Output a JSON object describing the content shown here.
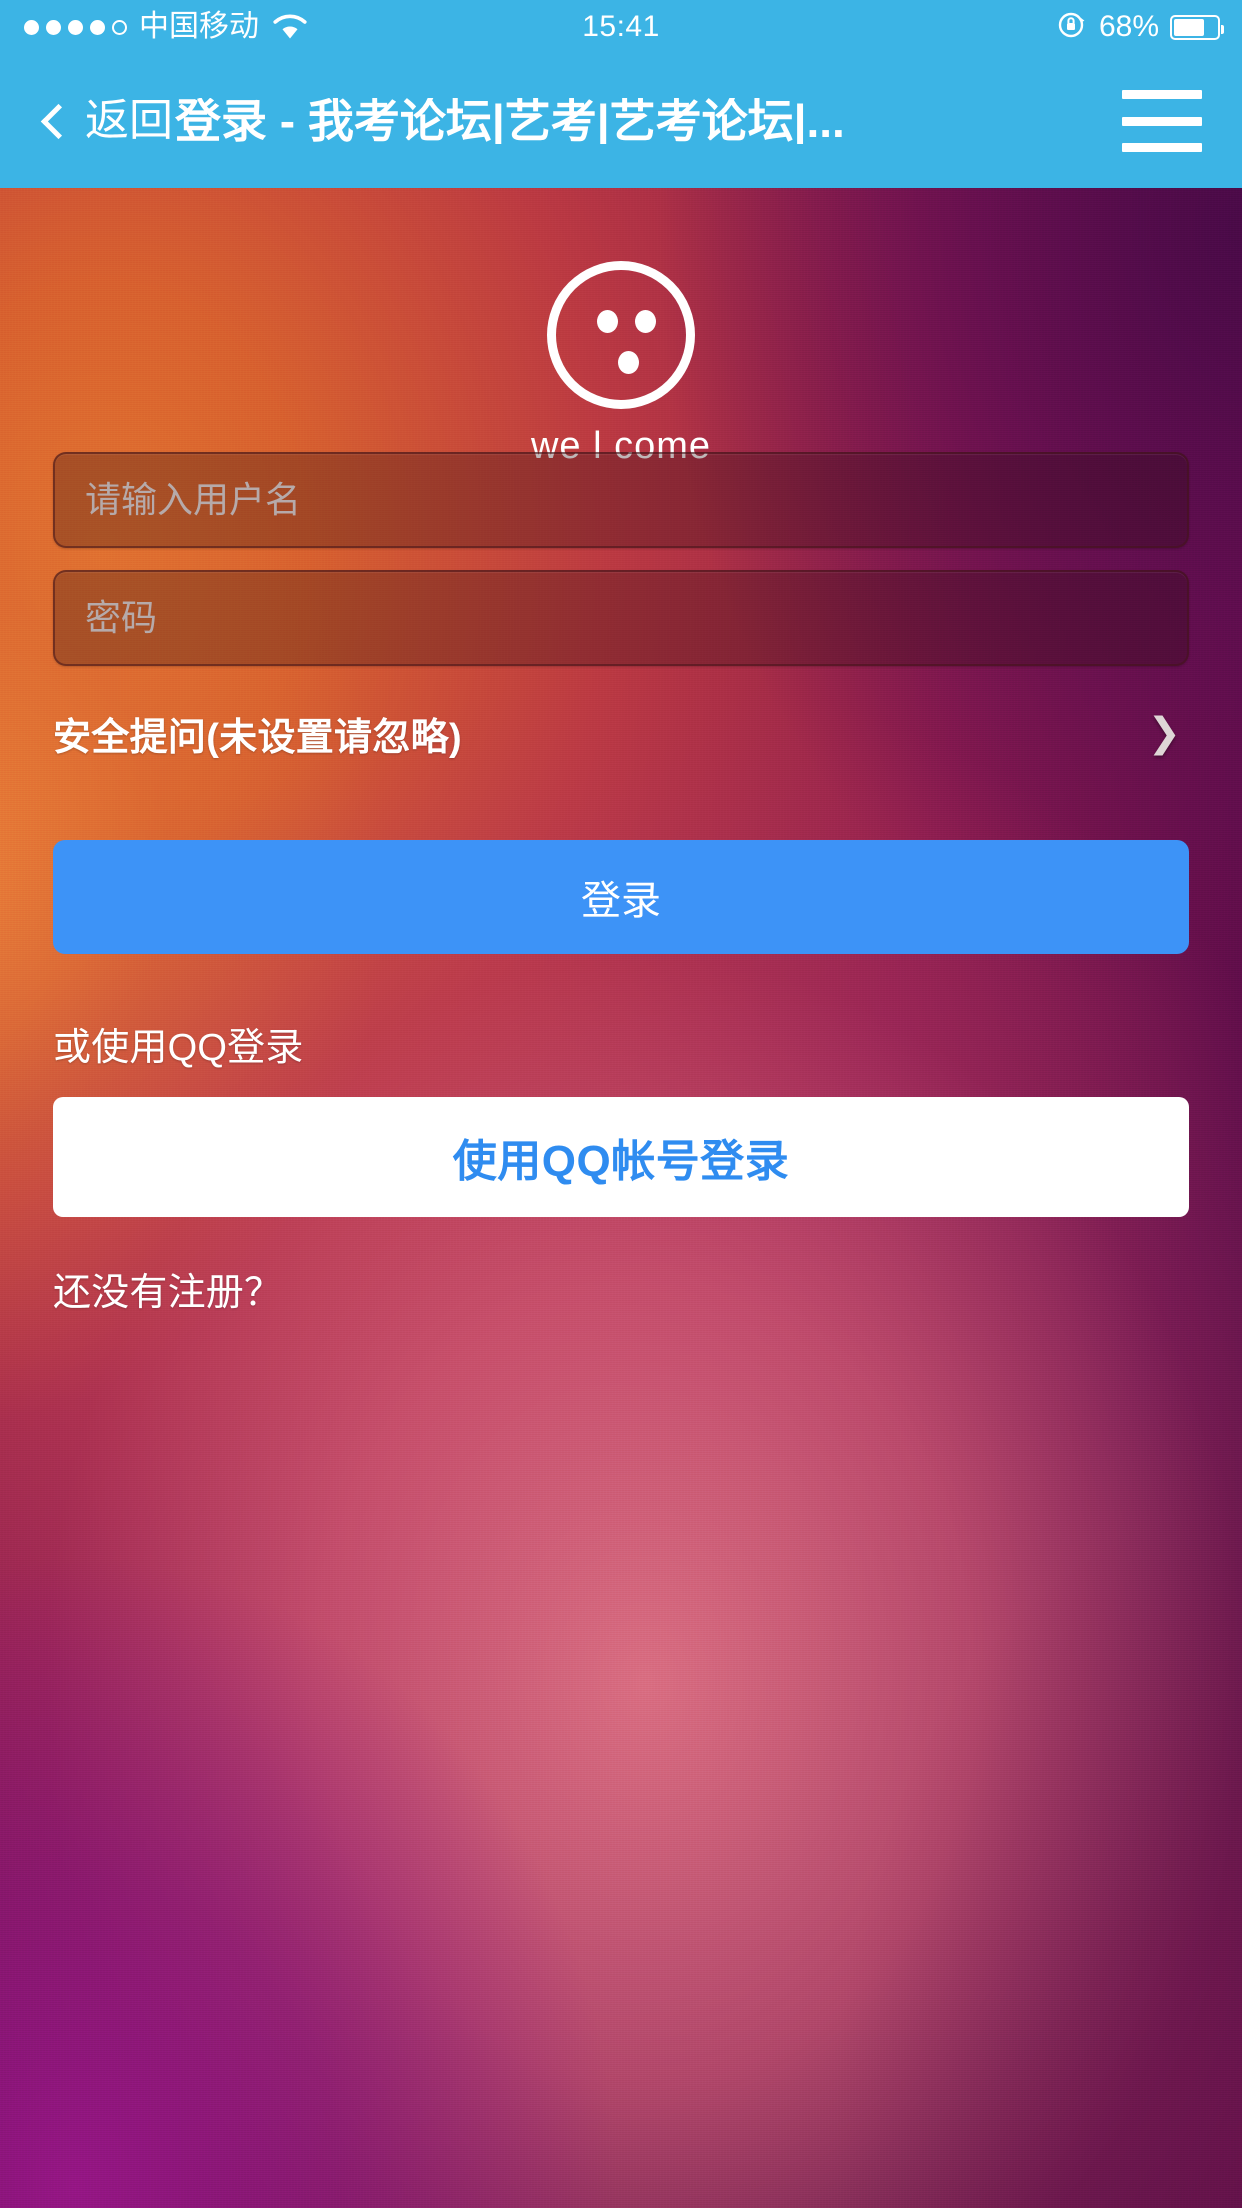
{
  "status_bar": {
    "carrier": "中国移动",
    "signal_dots_filled": 4,
    "signal_dots_total": 5,
    "wifi_icon": "wifi-icon",
    "time": "15:41",
    "rotation_lock_icon": "rotation-lock-icon",
    "battery_percent": "68%",
    "battery_level": 68
  },
  "nav_bar": {
    "back_icon": "chevron-left-icon",
    "back_label": "返回",
    "title": "登录 - 我考论坛|艺考|艺考论坛|...",
    "menu_icon": "hamburger-menu-icon"
  },
  "logo": {
    "icon": "bowling-ball-icon",
    "caption": "we l come"
  },
  "form": {
    "username": {
      "value": "",
      "placeholder": "请输入用户名"
    },
    "password": {
      "value": "",
      "placeholder": "密码"
    },
    "security_question": {
      "label": "安全提问(未设置请忽略)",
      "arrow_icon": "chevron-right-icon"
    },
    "login_button": "登录"
  },
  "qq": {
    "hint": "或使用QQ登录",
    "button": "使用QQ帐号登录"
  },
  "register": {
    "link": "还没有注册？"
  },
  "colors": {
    "nav_bar": "#3cb4e5",
    "login_button": "#3d93f7",
    "qq_button_bg": "#ffffff",
    "qq_button_text": "#2f8cf0",
    "text_primary": "#ffffff",
    "placeholder": "#b6aaaa"
  }
}
